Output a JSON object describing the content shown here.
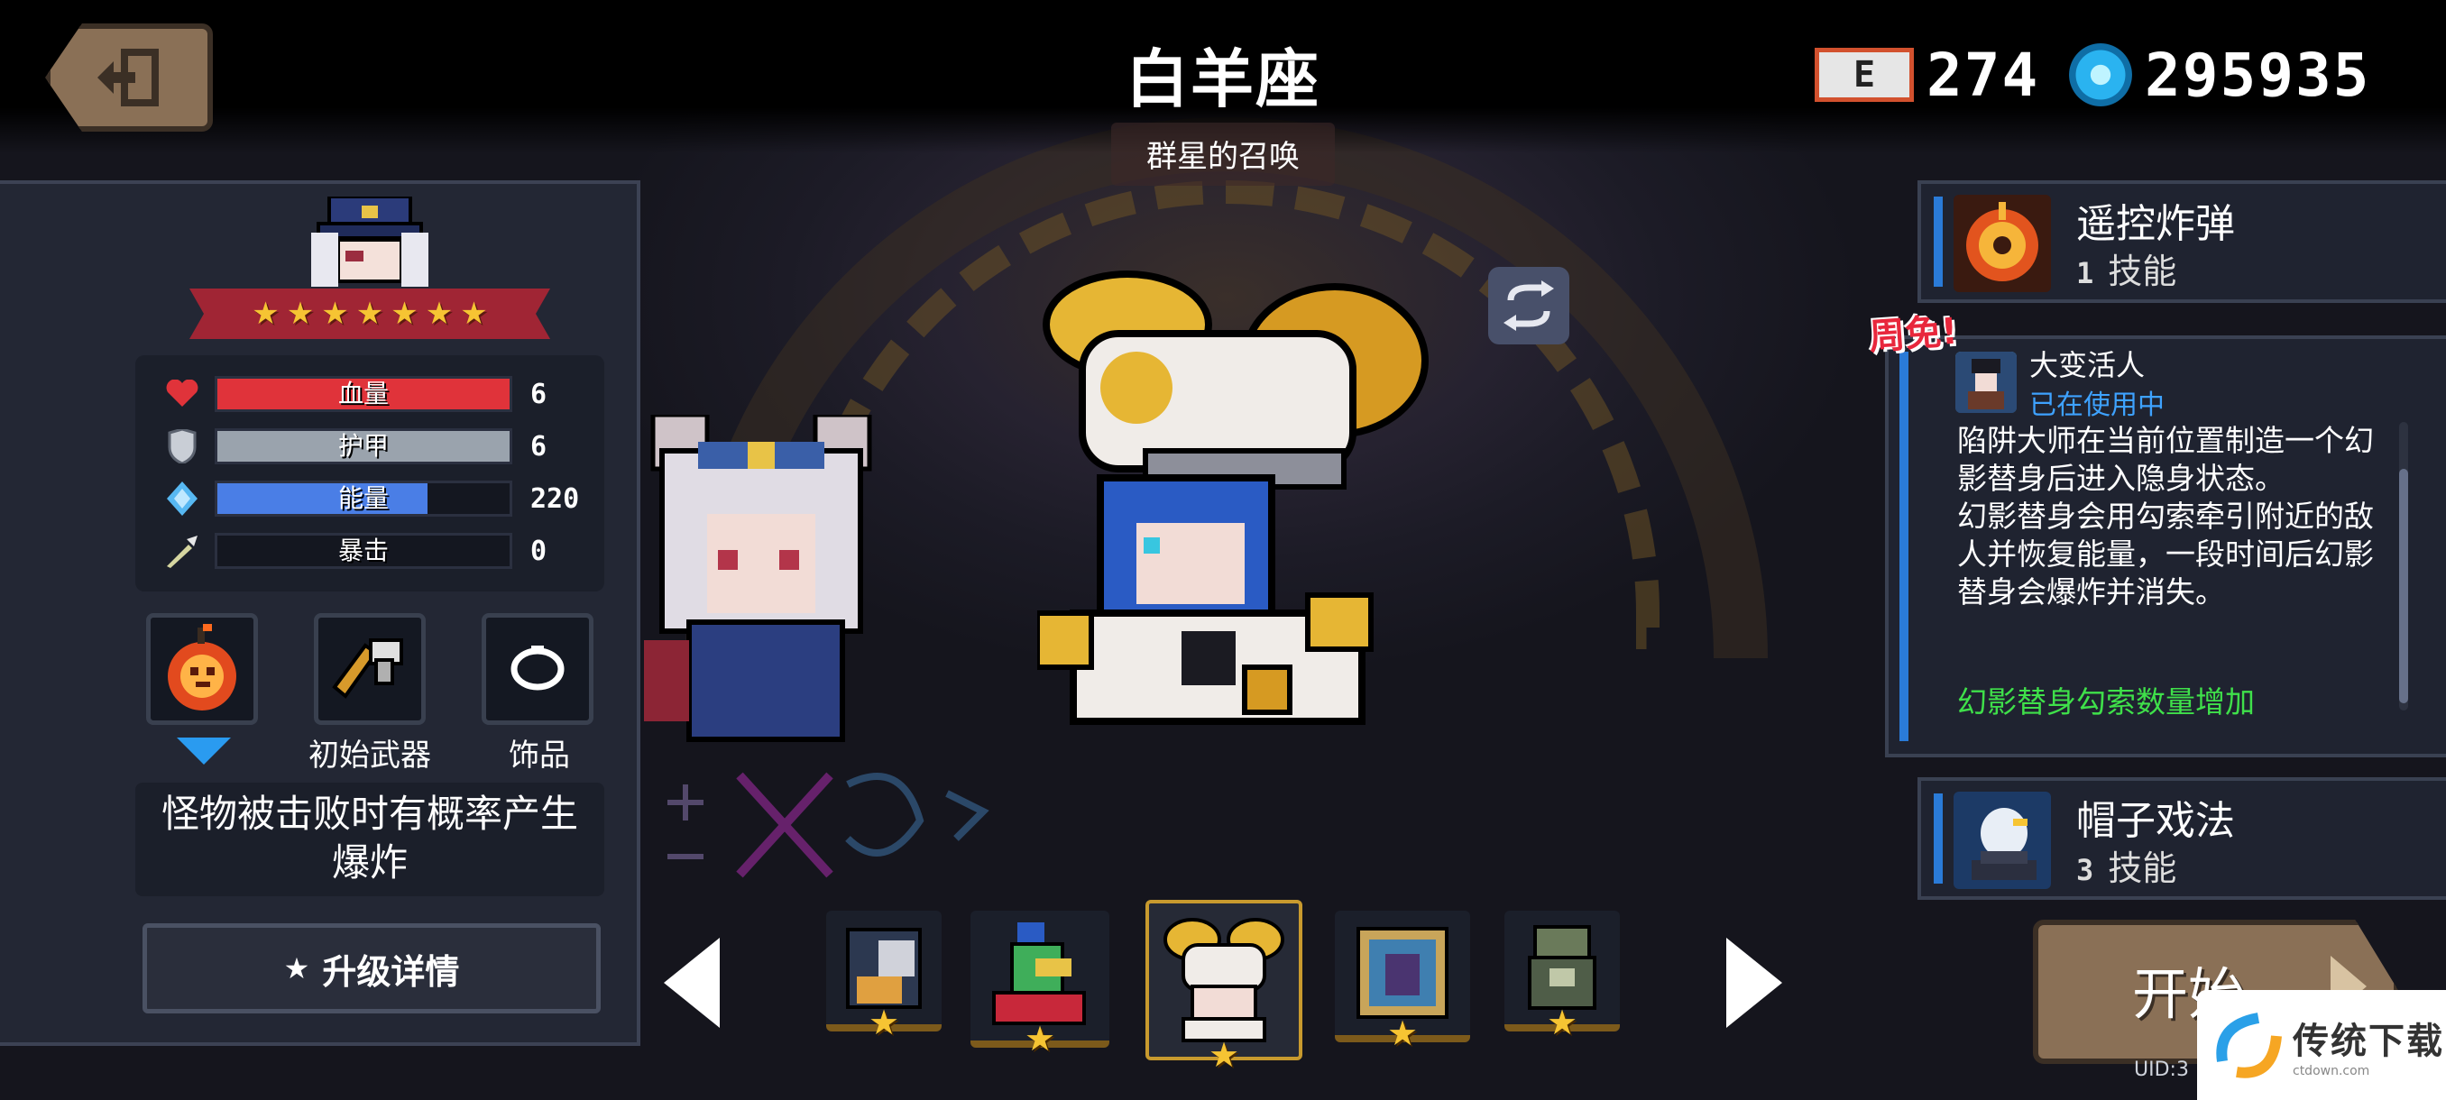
{
  "header": {
    "title": "白羊座",
    "subtitle": "群星的召唤",
    "currencies": [
      {
        "icon": "e-chip-icon",
        "icon_text": "E",
        "value": "274"
      },
      {
        "icon": "blue-gem-icon",
        "value": "295935"
      }
    ]
  },
  "hero": {
    "stars": 7,
    "stats": [
      {
        "label": "血量",
        "value": "6",
        "fill": 1.0,
        "color": "#e0333a",
        "icon": "heart-icon"
      },
      {
        "label": "护甲",
        "value": "6",
        "fill": 1.0,
        "color": "#9aa3ad",
        "icon": "shield-icon"
      },
      {
        "label": "能量",
        "value": "220",
        "fill": 0.72,
        "color": "#4a7ee6",
        "icon": "energy-crystal-icon"
      },
      {
        "label": "暴击",
        "value": "0",
        "fill": 0.0,
        "color": "#9aa3ad",
        "icon": "crit-sword-icon"
      }
    ],
    "slots": [
      {
        "name": "passive-skull-bomb",
        "label": ""
      },
      {
        "name": "initial-weapon",
        "label": "初始武器"
      },
      {
        "name": "accessory",
        "label": "饰品"
      }
    ],
    "passive_desc": "怪物被击败时有概率产生爆炸",
    "upgrade_label": "升级详情",
    "upgrade_icon": "★"
  },
  "skills": {
    "top": {
      "name": "遥控炸弹",
      "number": "1",
      "type": "技能"
    },
    "bottom": {
      "name": "帽子戏法",
      "number": "3",
      "type": "技能"
    },
    "talent": {
      "free_tag": "周免!",
      "name": "大变活人",
      "status": "已在使用中",
      "desc": "陷阱大师在当前位置制造一个幻影替身后进入隐身状态。\n幻影替身会用勾索牵引附近的敌人并恢复能量，一段时间后幻影替身会爆炸并消失。",
      "bonus": "幻影替身勾索数量增加"
    }
  },
  "carousel": {
    "skins": [
      {
        "stars": "★"
      },
      {
        "stars": "★"
      },
      {
        "stars": "★",
        "selected": true
      },
      {
        "stars": "★"
      },
      {
        "stars": "★"
      }
    ]
  },
  "footer": {
    "start_label": "开始",
    "uid": "UID:3"
  },
  "watermark": {
    "text": "传统下载",
    "url": "ctdown.com"
  },
  "colors": {
    "accent_blue": "#2a7bd8",
    "button_brown": "#8a7056",
    "free_red": "#e8273c",
    "bonus_green": "#3fe04a",
    "star_gold": "#f6c433"
  }
}
